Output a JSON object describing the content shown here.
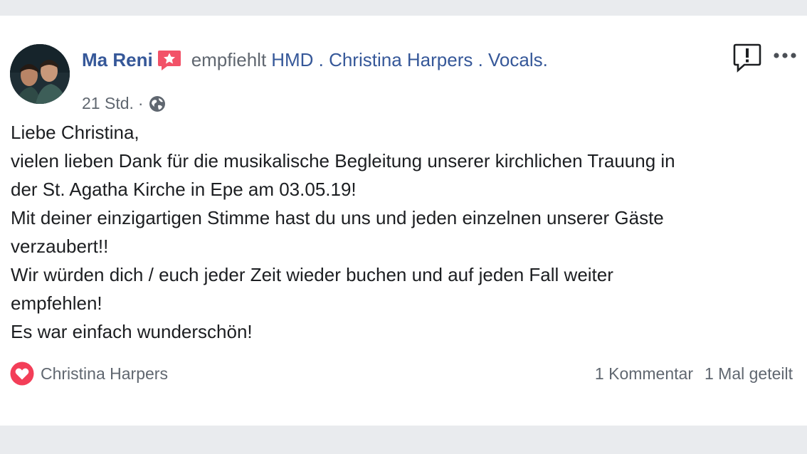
{
  "post": {
    "author": "Ma Reni",
    "action": "empfiehlt",
    "page": "HMD . Christina Harpers . Vocals.",
    "time": "21 Std.",
    "separator": "·",
    "privacy_icon": "globe-icon",
    "recommend_icon": "star-speech-bubble-icon",
    "report_icon": "exclamation-speech-bubble-icon",
    "more_icon": "ellipsis-icon",
    "body_lines": [
      "Liebe Christina,",
      "vielen lieben Dank für die musikalische Begleitung unserer kirchlichen Trauung in",
      "der St. Agatha Kirche in Epe am 03.05.19!",
      "Mit deiner einzigartigen Stimme hast du uns und jeden einzelnen unserer Gäste",
      "verzaubert!!",
      "Wir würden dich / euch jeder Zeit wieder buchen und auf jeden Fall weiter",
      "empfehlen!",
      "Es war einfach wunderschön!"
    ]
  },
  "footer": {
    "reaction_icon": "heart-icon",
    "reactors": "Christina Harpers",
    "comments": "1 Kommentar",
    "shares": "1 Mal geteilt"
  },
  "colors": {
    "link": "#365899",
    "secondary_text": "#606770",
    "body_text": "#1c1e21",
    "recommend_badge": "#f25268",
    "heart": "#f33e58",
    "page_background": "#e9ebee"
  }
}
